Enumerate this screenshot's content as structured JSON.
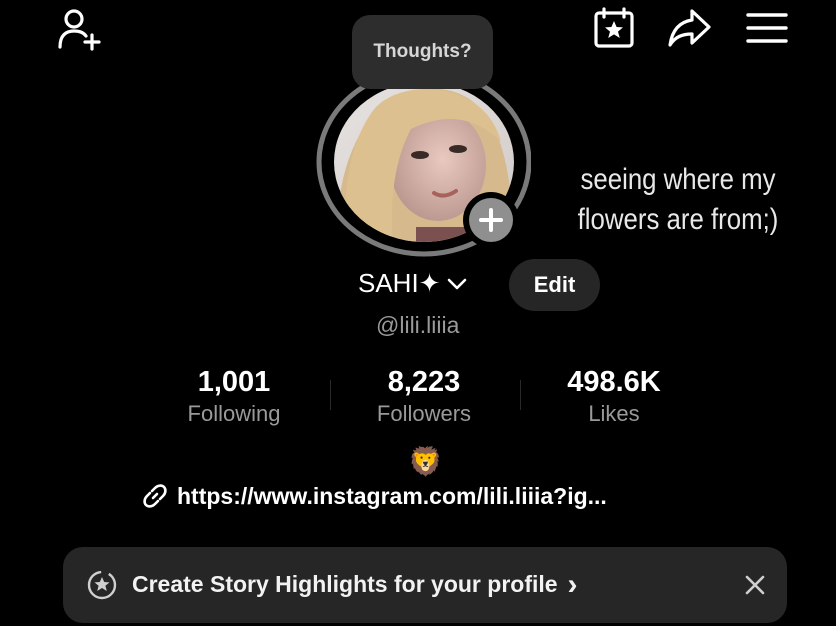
{
  "header": {
    "add_friend_icon": "person-add-icon",
    "calendar_icon": "calendar-star-icon",
    "share_icon": "share-icon",
    "menu_icon": "hamburger-menu-icon"
  },
  "profile": {
    "thought_bubble": "Thoughts?",
    "note": "seeing where my flowers are from;)",
    "display_name": "SAHI✦",
    "edit_label": "Edit",
    "username": "@lili.liiia",
    "bio_emoji": "🦁",
    "link": "https://www.instagram.com/lili.liiia?ig..."
  },
  "stats": [
    {
      "value": "1,001",
      "label": "Following"
    },
    {
      "value": "8,223",
      "label": "Followers"
    },
    {
      "value": "498.6K",
      "label": "Likes"
    }
  ],
  "banner": {
    "text": "Create Story Highlights for your profile",
    "chevron": "›"
  }
}
